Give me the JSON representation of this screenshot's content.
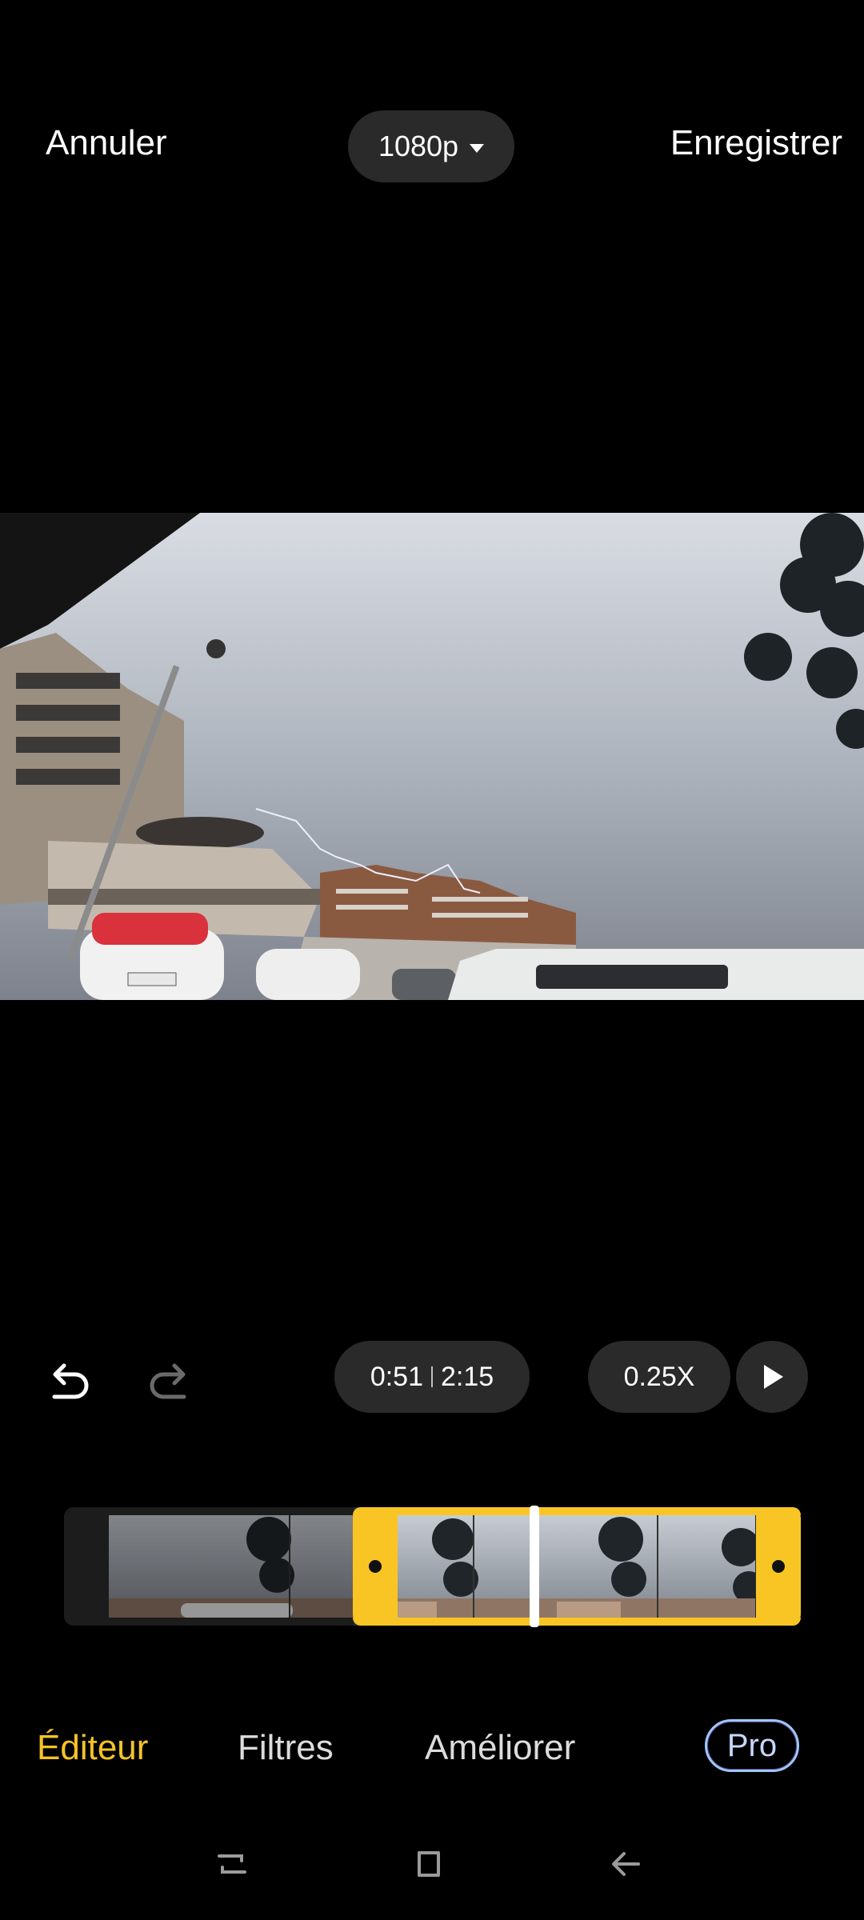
{
  "topbar": {
    "cancel_label": "Annuler",
    "resolution": "1080p",
    "save_label": "Enregistrer"
  },
  "playback": {
    "current_time": "0:51",
    "total_time": "2:15",
    "speed": "0.25X"
  },
  "tabs": [
    {
      "label": "Éditeur",
      "active": true
    },
    {
      "label": "Filtres",
      "active": false
    },
    {
      "label": "Améliorer",
      "active": false
    }
  ],
  "pro_badge": "Pro",
  "colors": {
    "accent": "#f5c227",
    "pill_bg": "#2a2a2a",
    "background": "#000000"
  },
  "icons": {
    "undo": "undo-icon",
    "redo": "redo-icon",
    "play": "play-icon",
    "dropdown": "caret-down-icon",
    "nav_recent": "recents-icon",
    "nav_home": "home-icon",
    "nav_back": "back-icon"
  }
}
